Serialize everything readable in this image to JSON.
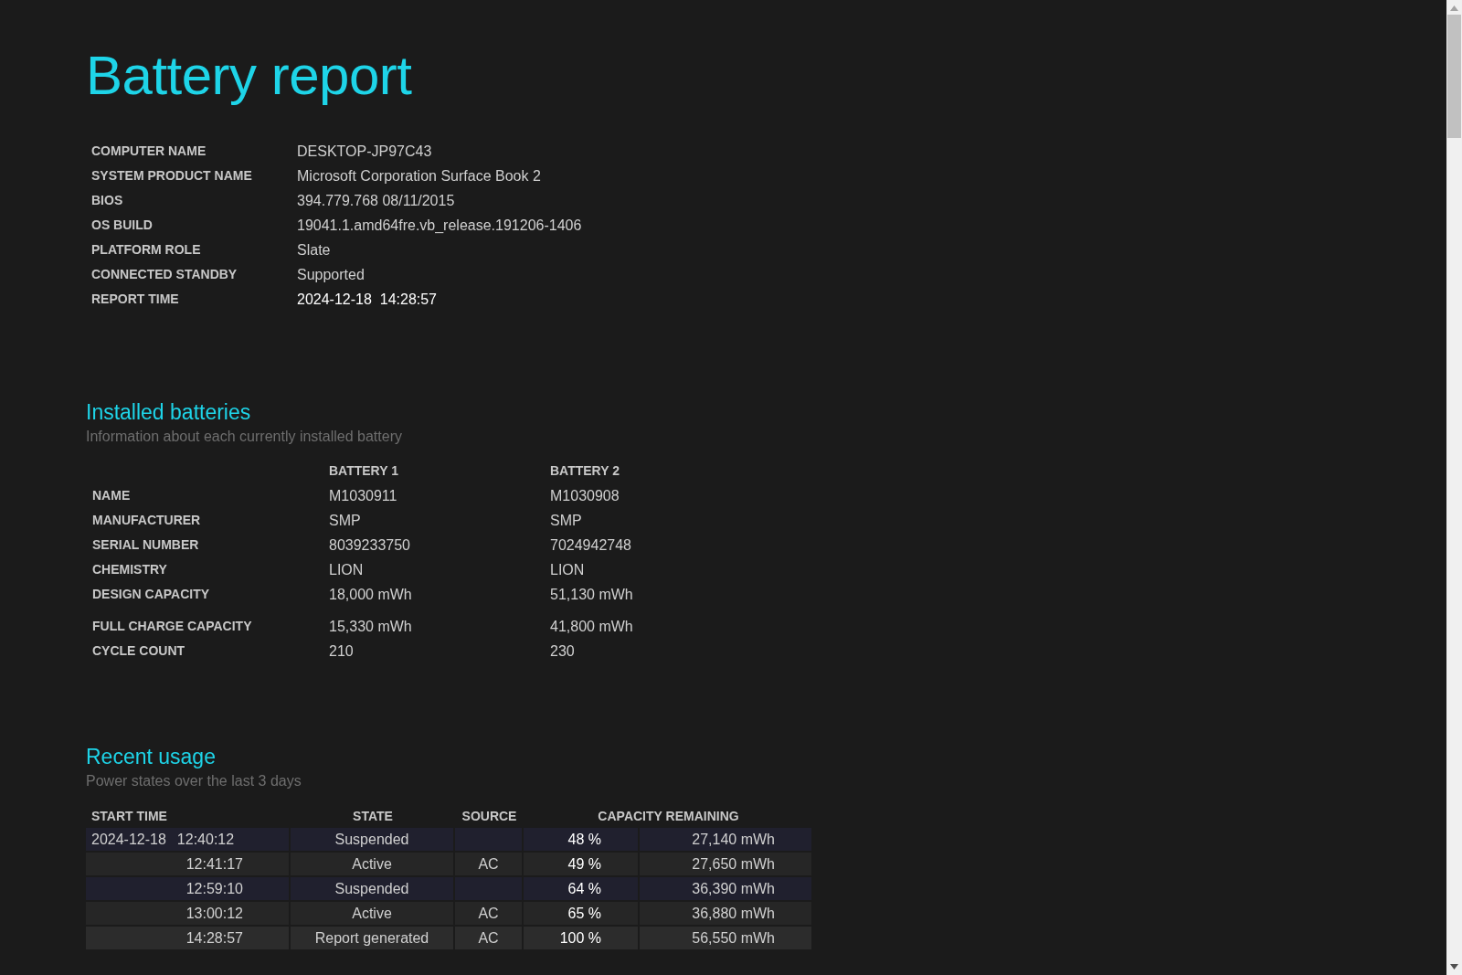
{
  "title": "Battery report",
  "system_info": [
    {
      "label": "COMPUTER NAME",
      "value": "DESKTOP-JP97C43"
    },
    {
      "label": "SYSTEM PRODUCT NAME",
      "value": "Microsoft Corporation Surface Book 2"
    },
    {
      "label": "BIOS",
      "value": "394.779.768 08/11/2015"
    },
    {
      "label": "OS BUILD",
      "value": "19041.1.amd64fre.vb_release.191206-1406"
    },
    {
      "label": "PLATFORM ROLE",
      "value": "Slate"
    },
    {
      "label": "CONNECTED STANDBY",
      "value": "Supported"
    },
    {
      "label": "REPORT TIME",
      "value": "2024-12-18  14:28:57"
    }
  ],
  "installed_batteries": {
    "heading": "Installed batteries",
    "subtitle": "Information about each currently installed battery",
    "columns": [
      "BATTERY 1",
      "BATTERY 2"
    ],
    "rows": [
      {
        "label": "NAME",
        "values": [
          "M1030911",
          "M1030908"
        ]
      },
      {
        "label": "MANUFACTURER",
        "values": [
          "SMP",
          "SMP"
        ]
      },
      {
        "label": "SERIAL NUMBER",
        "values": [
          "8039233750",
          "7024942748"
        ]
      },
      {
        "label": "CHEMISTRY",
        "values": [
          "LION",
          "LION"
        ]
      },
      {
        "label": "DESIGN CAPACITY",
        "values": [
          "18,000 mWh",
          "51,130 mWh"
        ]
      },
      {
        "label": "FULL CHARGE CAPACITY",
        "values": [
          "15,330 mWh",
          "41,800 mWh"
        ]
      },
      {
        "label": "CYCLE COUNT",
        "values": [
          "210",
          "230"
        ]
      }
    ]
  },
  "recent_usage": {
    "heading": "Recent usage",
    "subtitle": "Power states over the last 3 days",
    "columns": [
      "START TIME",
      "STATE",
      "SOURCE",
      "CAPACITY REMAINING"
    ],
    "rows": [
      {
        "kind": "suspended",
        "date": "2024-12-18",
        "time": "12:40:12",
        "state": "Suspended",
        "source": "",
        "percent": "48 %",
        "capacity": "27,140 mWh"
      },
      {
        "kind": "active",
        "time": "12:41:17",
        "state": "Active",
        "source": "AC",
        "percent": "49 %",
        "capacity": "27,650 mWh"
      },
      {
        "kind": "suspended",
        "time": "12:59:10",
        "state": "Suspended",
        "source": "",
        "percent": "64 %",
        "capacity": "36,390 mWh"
      },
      {
        "kind": "active",
        "time": "13:00:12",
        "state": "Active",
        "source": "AC",
        "percent": "65 %",
        "capacity": "36,880 mWh"
      },
      {
        "kind": "report",
        "time": "14:28:57",
        "state": "Report generated",
        "source": "AC",
        "percent": "100 %",
        "capacity": "56,550 mWh"
      }
    ]
  }
}
